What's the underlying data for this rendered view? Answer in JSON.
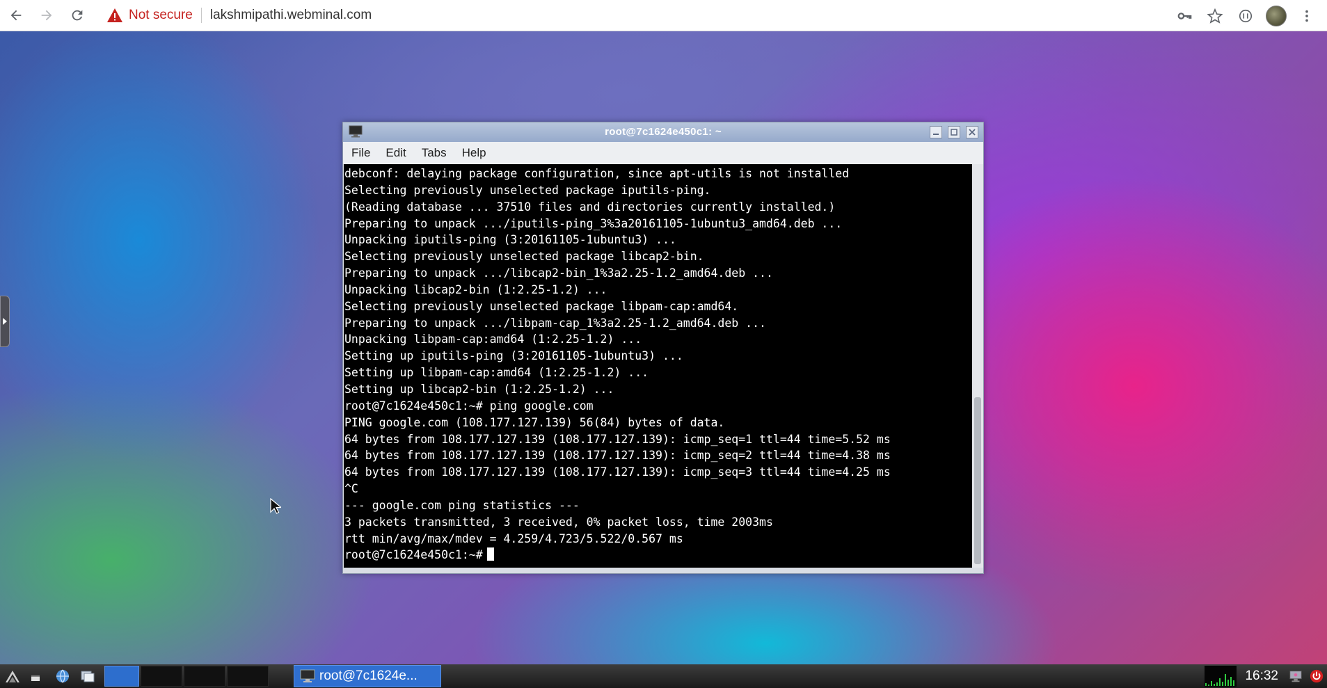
{
  "browser": {
    "security_label": "Not secure",
    "url": "lakshmipathi.webminal.com"
  },
  "terminal": {
    "title": "root@7c1624e450c1: ~",
    "menu": [
      "File",
      "Edit",
      "Tabs",
      "Help"
    ],
    "lines": [
      "debconf: delaying package configuration, since apt-utils is not installed",
      "Selecting previously unselected package iputils-ping.",
      "(Reading database ... 37510 files and directories currently installed.)",
      "Preparing to unpack .../iputils-ping_3%3a20161105-1ubuntu3_amd64.deb ...",
      "Unpacking iputils-ping (3:20161105-1ubuntu3) ...",
      "Selecting previously unselected package libcap2-bin.",
      "Preparing to unpack .../libcap2-bin_1%3a2.25-1.2_amd64.deb ...",
      "Unpacking libcap2-bin (1:2.25-1.2) ...",
      "Selecting previously unselected package libpam-cap:amd64.",
      "Preparing to unpack .../libpam-cap_1%3a2.25-1.2_amd64.deb ...",
      "Unpacking libpam-cap:amd64 (1:2.25-1.2) ...",
      "Setting up iputils-ping (3:20161105-1ubuntu3) ...",
      "Setting up libpam-cap:amd64 (1:2.25-1.2) ...",
      "Setting up libcap2-bin (1:2.25-1.2) ...",
      "root@7c1624e450c1:~# ping google.com",
      "PING google.com (108.177.127.139) 56(84) bytes of data.",
      "64 bytes from 108.177.127.139 (108.177.127.139): icmp_seq=1 ttl=44 time=5.52 ms",
      "64 bytes from 108.177.127.139 (108.177.127.139): icmp_seq=2 ttl=44 time=4.38 ms",
      "64 bytes from 108.177.127.139 (108.177.127.139): icmp_seq=3 ttl=44 time=4.25 ms",
      "^C",
      "--- google.com ping statistics ---",
      "3 packets transmitted, 3 received, 0% packet loss, time 2003ms",
      "rtt min/avg/max/mdev = 4.259/4.723/5.522/0.567 ms"
    ],
    "prompt": "root@7c1624e450c1:~#"
  },
  "taskbar": {
    "task_label": "root@7c1624e...",
    "clock": "16:32"
  },
  "colors": {
    "security_red": "#c5221f",
    "taskbar_active": "#2f6fd0",
    "terminal_bg": "#000000",
    "terminal_fg": "#ffffff"
  },
  "icons": {
    "browser": [
      "back-arrow-icon",
      "forward-arrow-icon",
      "reload-icon",
      "warning-icon",
      "key-icon",
      "star-icon",
      "extension-icon",
      "profile-avatar",
      "more-menu-icon"
    ],
    "taskbar": [
      "start-menu-icon",
      "show-desktop-icon",
      "browser-icon",
      "file-manager-icon",
      "terminal-icon",
      "cpu-graph",
      "network-icon",
      "power-icon"
    ]
  }
}
